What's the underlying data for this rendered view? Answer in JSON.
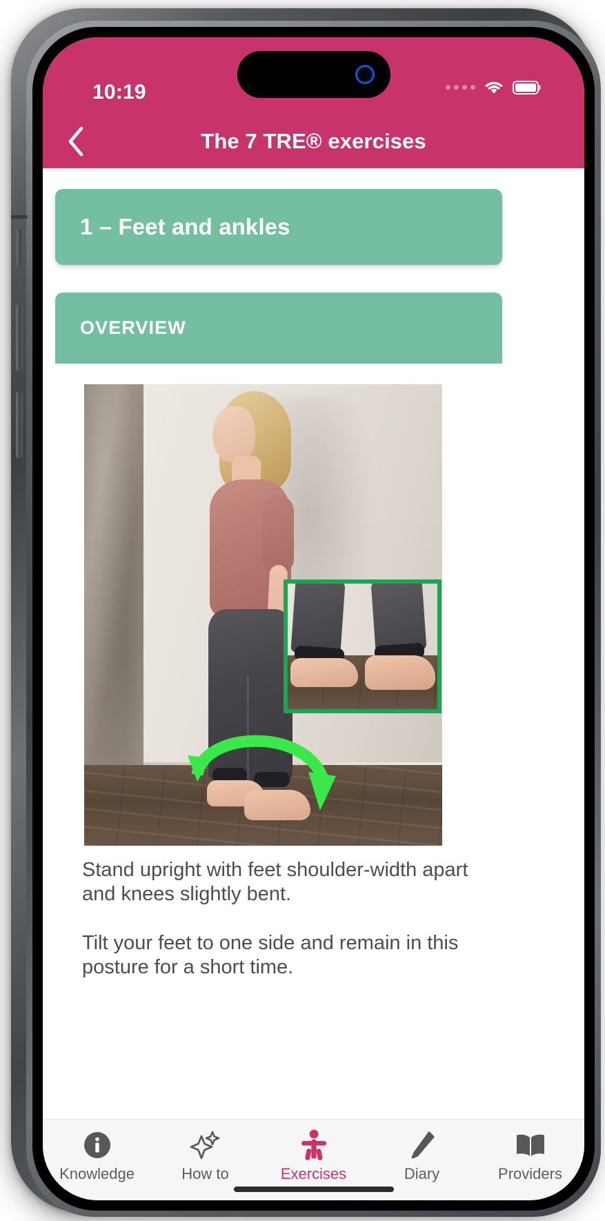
{
  "status_bar": {
    "time": "10:19",
    "cellular_icon": "cellular-dots-icon",
    "wifi_icon": "wifi-icon",
    "battery_icon": "battery-full-icon"
  },
  "header": {
    "back_icon": "chevron-left-icon",
    "title": "The 7 TRE® exercises",
    "background_color": "#C9336B"
  },
  "main": {
    "exercise_card": {
      "title": "1 – Feet and ankles",
      "background_color": "#74BFA2"
    },
    "section_card": {
      "title": "OVERVIEW",
      "background_color": "#74BFA2"
    },
    "illustration": {
      "name": "exercise-photo",
      "alt": "Woman standing upright against a wall with bare feet on a wooden floor, green curved arrow showing the tilting motion and a green box highlighting the feet",
      "callout_box_color": "#1CA554",
      "arrow_color": "#3BE84A"
    },
    "paragraphs": [
      "Stand upright with feet shoulder-width apart and knees slightly bent.",
      "Tilt your feet to one side and remain in this posture for a short time."
    ]
  },
  "tab_bar": {
    "active_color": "#C9336B",
    "inactive_color": "#5C5C5E",
    "items": [
      {
        "label": "Knowledge",
        "icon": "info-circle-icon",
        "active": false
      },
      {
        "label": "How to",
        "icon": "sparkles-icon",
        "active": false
      },
      {
        "label": "Exercises",
        "icon": "person-exercise-icon",
        "active": true
      },
      {
        "label": "Diary",
        "icon": "pen-icon",
        "active": false
      },
      {
        "label": "Providers",
        "icon": "book-open-icon",
        "active": false
      }
    ]
  }
}
